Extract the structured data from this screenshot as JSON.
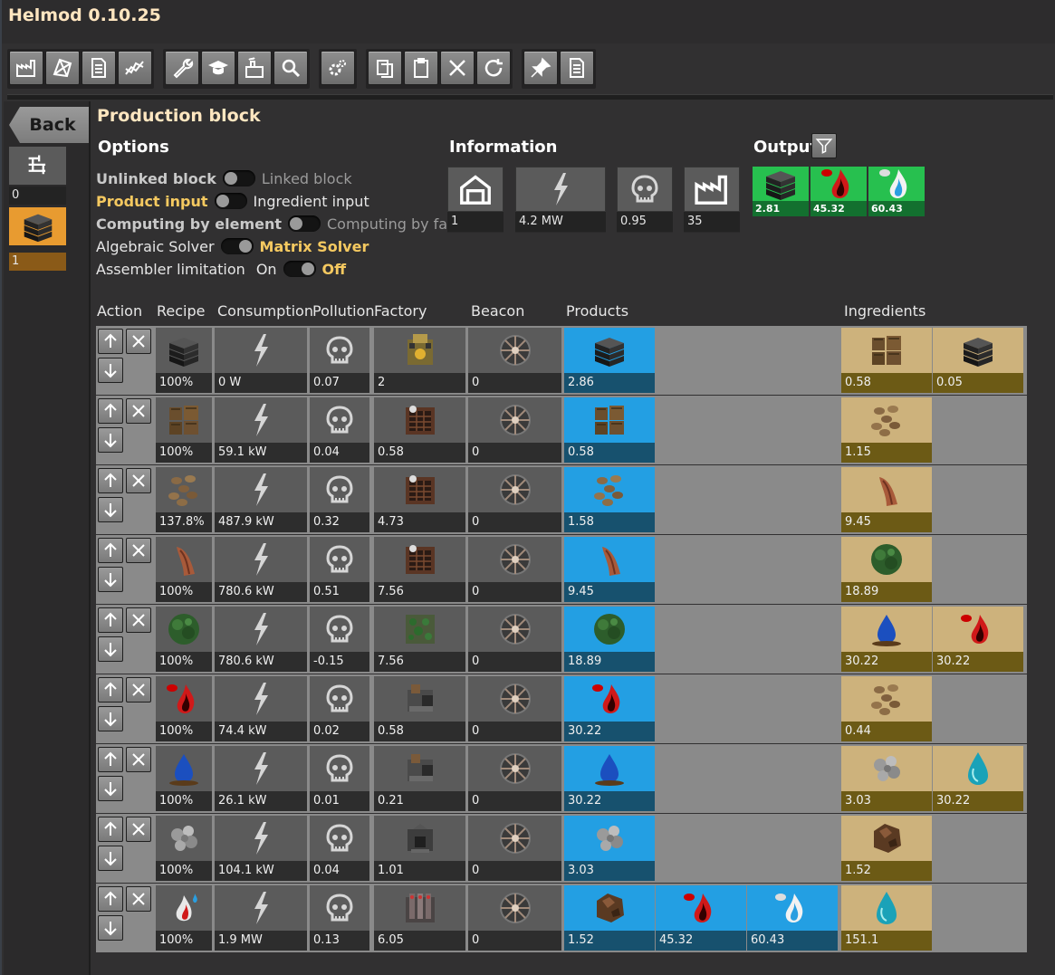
{
  "app": {
    "title": "Helmod 0.10.25"
  },
  "left": {
    "back": "Back",
    "slot0_value": "0",
    "slot1_value": "1"
  },
  "block": {
    "title": "Production block"
  },
  "options": {
    "heading": "Options",
    "unlinked": "Unlinked block",
    "linked": "Linked block",
    "product_input": "Product input",
    "ingredient_input": "Ingredient input",
    "by_element": "Computing by element",
    "by_factory": "Computing by factory",
    "algebraic": "Algebraic Solver",
    "matrix": "Matrix Solver",
    "assembler": "Assembler limitation",
    "on": "On",
    "off": "Off"
  },
  "information": {
    "heading": "Information",
    "count": "1",
    "power": "4.2 MW",
    "pollution": "0.95",
    "factories": "35"
  },
  "output": {
    "heading": "Output",
    "items": [
      {
        "icon": "solid-fuel-icon",
        "value": "2.81"
      },
      {
        "icon": "heavy-oil-icon",
        "value": "45.32"
      },
      {
        "icon": "light-oil-icon",
        "value": "60.43"
      }
    ]
  },
  "columns": {
    "action": "Action",
    "recipe": "Recipe",
    "consumption": "Consumption",
    "pollution": "Pollution",
    "factory": "Factory",
    "beacon": "Beacon",
    "products": "Products",
    "ingredients": "Ingredients"
  },
  "rows": [
    {
      "recipe": "100%",
      "consumption": "0 W",
      "pollution": "0.07",
      "factory": "2",
      "beacon": "0",
      "products": [
        "2.86"
      ],
      "ingredients": [
        "0.58",
        "0.05"
      ]
    },
    {
      "recipe": "100%",
      "consumption": "59.1 kW",
      "pollution": "0.04",
      "factory": "0.58",
      "beacon": "0",
      "products": [
        "0.58"
      ],
      "ingredients": [
        "1.15"
      ]
    },
    {
      "recipe": "137.8%",
      "consumption": "487.9 kW",
      "pollution": "0.32",
      "factory": "4.73",
      "beacon": "0",
      "products": [
        "1.58"
      ],
      "ingredients": [
        "9.45"
      ]
    },
    {
      "recipe": "100%",
      "consumption": "780.6 kW",
      "pollution": "0.51",
      "factory": "7.56",
      "beacon": "0",
      "products": [
        "9.45"
      ],
      "ingredients": [
        "18.89"
      ]
    },
    {
      "recipe": "100%",
      "consumption": "780.6 kW",
      "pollution": "-0.15",
      "factory": "7.56",
      "beacon": "0",
      "products": [
        "18.89"
      ],
      "ingredients": [
        "30.22",
        "30.22"
      ]
    },
    {
      "recipe": "100%",
      "consumption": "74.4 kW",
      "pollution": "0.02",
      "factory": "0.58",
      "beacon": "0",
      "products": [
        "30.22"
      ],
      "ingredients": [
        "0.44"
      ]
    },
    {
      "recipe": "100%",
      "consumption": "26.1 kW",
      "pollution": "0.01",
      "factory": "0.21",
      "beacon": "0",
      "products": [
        "30.22"
      ],
      "ingredients": [
        "3.03",
        "30.22"
      ]
    },
    {
      "recipe": "100%",
      "consumption": "104.1 kW",
      "pollution": "0.04",
      "factory": "1.01",
      "beacon": "0",
      "products": [
        "3.03"
      ],
      "ingredients": [
        "1.52"
      ]
    },
    {
      "recipe": "100%",
      "consumption": "1.9 MW",
      "pollution": "0.13",
      "factory": "6.05",
      "beacon": "0",
      "products": [
        "1.52",
        "45.32",
        "60.43"
      ],
      "ingredients": [
        "151.1"
      ]
    }
  ],
  "icons": {
    "row_recipes": [
      "solid-fuel-icon",
      "wood-icon",
      "seed-icon",
      "sapling-icon",
      "tree-icon",
      "heavy-oil-icon",
      "water-icon",
      "gravel-icon",
      "oil-refinery-icon"
    ],
    "row_factories": [
      "assembler-icon",
      "greenhouse-icon",
      "greenhouse-icon",
      "greenhouse-icon",
      "tree-farm-icon",
      "crusher-icon",
      "crusher-icon",
      "mining-drill-icon",
      "refinery-icon"
    ]
  }
}
